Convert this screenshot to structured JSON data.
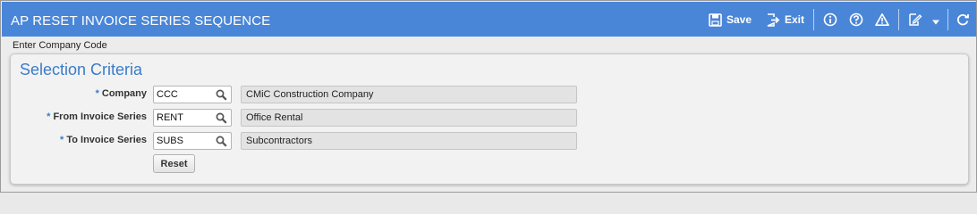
{
  "header": {
    "title": "AP RESET INVOICE SERIES SEQUENCE",
    "save_label": "Save",
    "exit_label": "Exit",
    "icons": [
      "save-icon",
      "exit-icon",
      "info-icon",
      "help-icon",
      "warning-icon",
      "edit-icon",
      "dropdown-icon",
      "refresh-icon"
    ]
  },
  "subtitle": "Enter Company Code",
  "panel": {
    "title": "Selection Criteria",
    "required_marker": "*",
    "fields": [
      {
        "label": "Company",
        "code": "CCC",
        "description": "CMiC Construction Company"
      },
      {
        "label": "From Invoice Series",
        "code": "RENT",
        "description": "Office Rental"
      },
      {
        "label": "To Invoice Series",
        "code": "SUBS",
        "description": "Subcontractors"
      }
    ],
    "reset_label": "Reset"
  },
  "colors": {
    "header_bg": "#4a86d8",
    "panel_title": "#3a7cc9"
  }
}
